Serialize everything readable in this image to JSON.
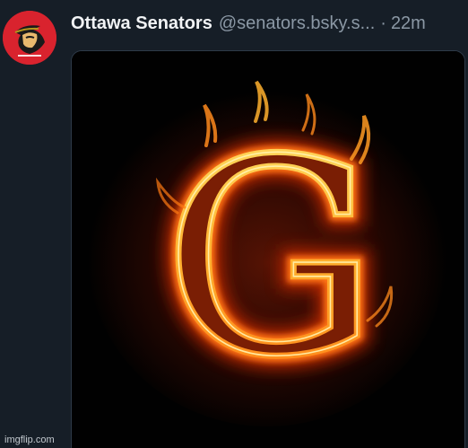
{
  "post": {
    "author": {
      "display_name": "Ottawa Senators",
      "handle": "@senators.bsky.s...",
      "avatar_icon": "ottawa-senators-logo-icon"
    },
    "separator": "·",
    "timestamp": "22m",
    "embed": {
      "image_icon": "flaming-letter-g-image",
      "letter": "G"
    }
  },
  "watermark": {
    "text": "imgflip.com"
  },
  "colors": {
    "background": "#161e27",
    "text_primary": "#f1f3f5",
    "text_secondary": "#8b98a5",
    "avatar_red": "#d9232e",
    "flame_yellow": "#ffe36a",
    "flame_orange": "#ff8a1c",
    "flame_red": "#c72a05"
  }
}
